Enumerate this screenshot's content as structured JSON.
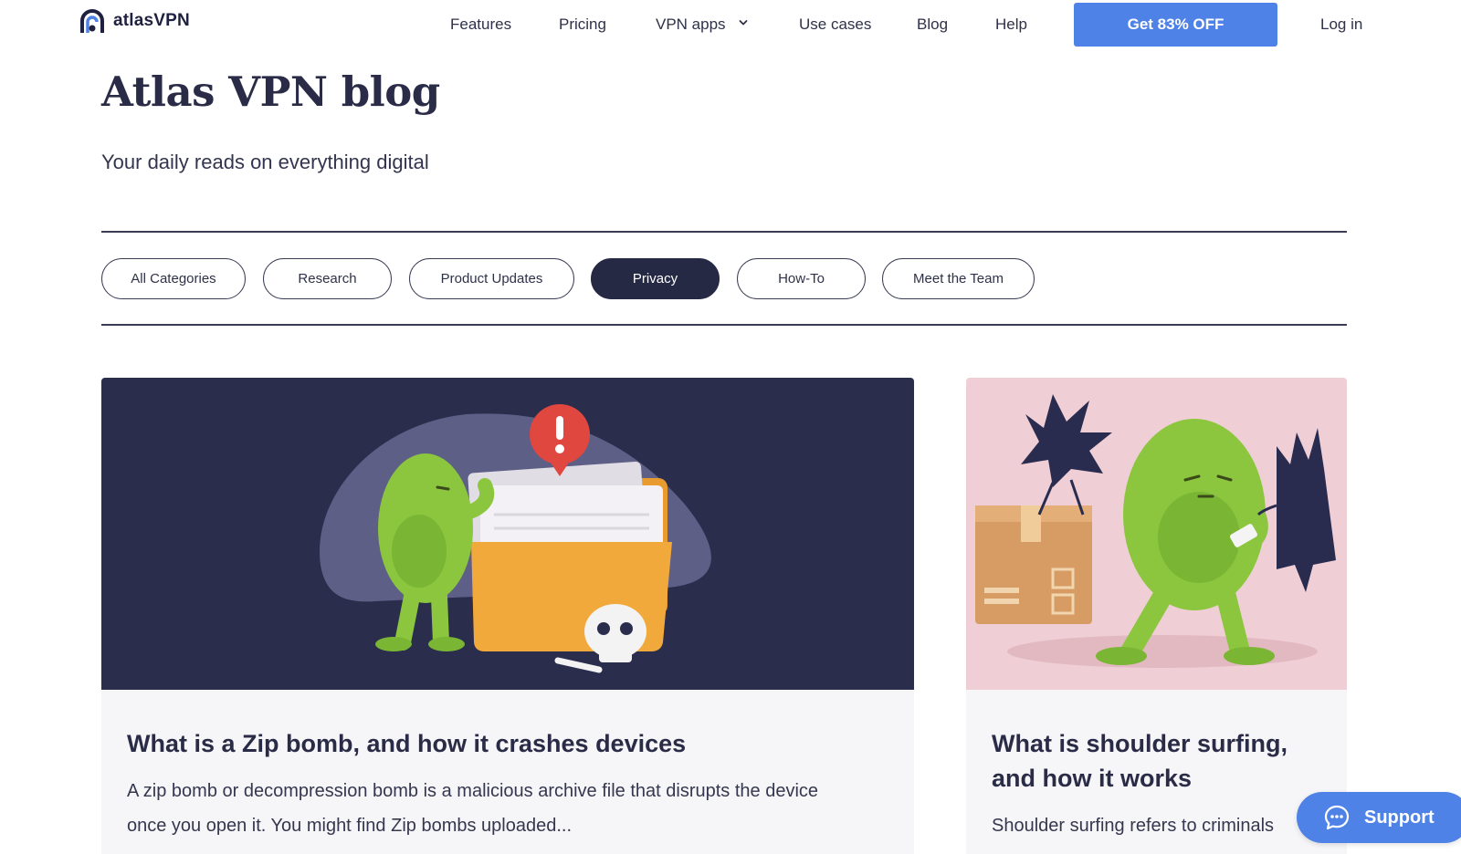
{
  "header": {
    "logo_text": "atlasVPN",
    "nav": [
      {
        "label": "Features"
      },
      {
        "label": "Pricing"
      },
      {
        "label": "VPN apps"
      },
      {
        "label": "Use cases"
      },
      {
        "label": "Blog"
      },
      {
        "label": "Help"
      }
    ],
    "cta_label": "Get 83% OFF",
    "login_label": "Log in",
    "vpn_apps_icon": "chevron-down-icon"
  },
  "hero": {
    "title": "Atlas VPN blog",
    "subtitle": "Your daily reads on everything digital"
  },
  "filters": {
    "items": [
      {
        "label": "All Categories",
        "active": false
      },
      {
        "label": "Research",
        "active": false
      },
      {
        "label": "Product Updates",
        "active": false
      },
      {
        "label": "Privacy",
        "active": true
      },
      {
        "label": "How-To",
        "active": false
      },
      {
        "label": "Meet the Team",
        "active": false
      }
    ]
  },
  "posts": [
    {
      "title": "What is a Zip bomb, and how it crashes devices",
      "excerpt_line1": "A zip bomb or decompression bomb is a malicious archive file that disrupts the device",
      "excerpt_line2": "once you open it. You might find Zip bombs uploaded..."
    },
    {
      "title_line1": "What is shoulder surfing,",
      "title_line2": "and how it works",
      "excerpt_line1": "Shoulder surfing refers to criminals"
    }
  ],
  "support": {
    "label": "Support",
    "icon": "chat-bubble-icon"
  },
  "colors": {
    "accent": "#4f82e6",
    "navy": "#262944",
    "card_dark_bg": "#2b2d4d",
    "card_pink_bg": "#efcfd5",
    "mascot_green": "#8cc63e"
  }
}
